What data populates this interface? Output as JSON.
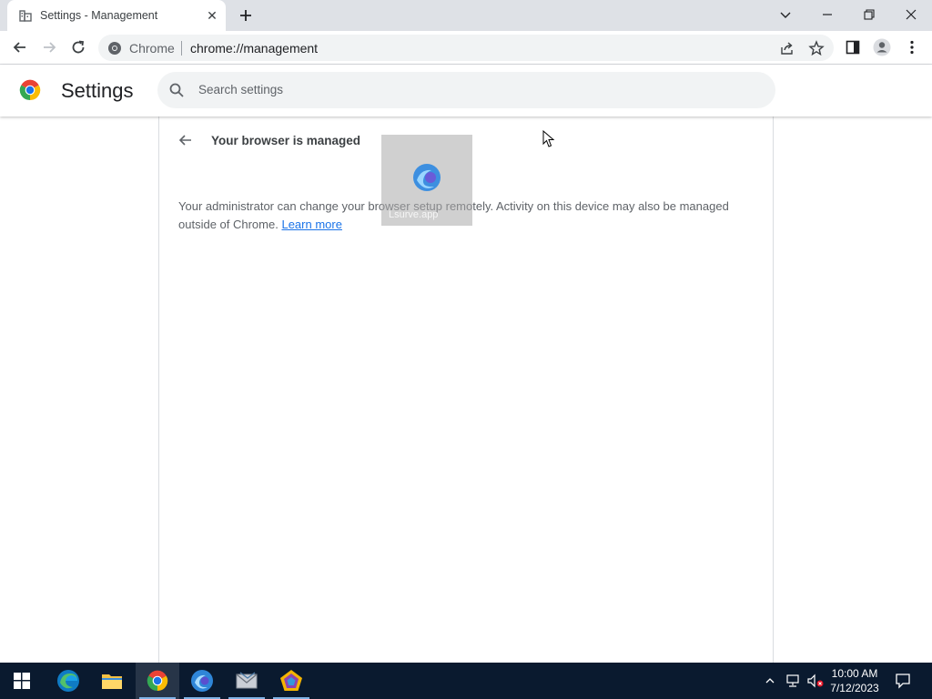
{
  "tab": {
    "title": "Settings - Management",
    "close_glyph": "✕"
  },
  "window_controls": [
    "chevron-down-icon",
    "minimize-icon",
    "restore-icon",
    "close-icon"
  ],
  "omnibox": {
    "chip_label": "Chrome",
    "url": "chrome://management"
  },
  "settings": {
    "title": "Settings",
    "search_placeholder": "Search settings"
  },
  "management": {
    "heading": "Your browser is managed",
    "description": "Your administrator can change your browser setup remotely. Activity on this device may also be managed outside of Chrome.",
    "learn_more": "Learn more"
  },
  "overlay": {
    "label": "Lsurve.app"
  },
  "taskbar": {
    "apps": [
      "start-icon",
      "edge-icon",
      "file-explorer-icon",
      "chrome-icon",
      "app-icon-blue",
      "app-icon-mail",
      "app-icon-pentagon"
    ],
    "active_app": "chrome-icon"
  },
  "clock": {
    "time": "10:00 AM",
    "date": "7/12/2023"
  },
  "colors": {
    "accent": "#1a73e8",
    "tabstrip": "#dee1e6",
    "omnibox": "#f1f3f4",
    "taskbar": "#0a1a2f"
  }
}
